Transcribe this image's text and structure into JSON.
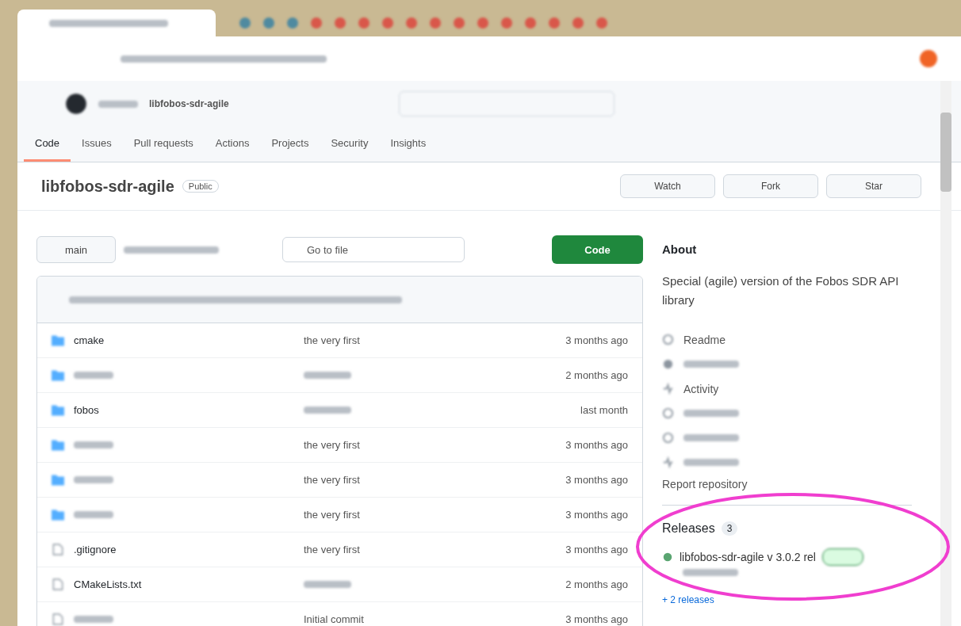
{
  "header": {
    "repo": "libfobos-sdr-agile"
  },
  "repo": {
    "name": "libfobos-sdr-agile",
    "visibility": "Public"
  },
  "nav_tabs": [
    {
      "label": "Code",
      "selected": true
    },
    {
      "label": "Issues",
      "selected": false
    },
    {
      "label": "Pull requests",
      "selected": false
    },
    {
      "label": "Actions",
      "selected": false
    },
    {
      "label": "Projects",
      "selected": false
    },
    {
      "label": "Security",
      "selected": false
    },
    {
      "label": "Insights",
      "selected": false
    }
  ],
  "repo_actions": [
    "Watch",
    "Fork",
    "Star"
  ],
  "branch": "main",
  "file_search": {
    "placeholder": "Go to file"
  },
  "code_button": "Code",
  "files": [
    {
      "kind": "folder",
      "name": "cmake",
      "message": "the very first",
      "age": "3 months ago"
    },
    {
      "kind": "folder",
      "age": "2 months ago"
    },
    {
      "kind": "folder",
      "name": "fobos",
      "age": "last month"
    },
    {
      "kind": "folder",
      "message": "the very first",
      "age": "3 months ago"
    },
    {
      "kind": "folder",
      "message": "the very first",
      "age": "3 months ago"
    },
    {
      "kind": "folder",
      "message": "the very first",
      "age": "3 months ago"
    },
    {
      "kind": "file",
      "name": ".gitignore",
      "message": "the very first",
      "age": "3 months ago"
    },
    {
      "kind": "file",
      "name": "CMakeLists.txt",
      "age": "2 months ago"
    },
    {
      "kind": "file",
      "message": "Initial commit",
      "age": "3 months ago"
    }
  ],
  "about": {
    "title": "About",
    "description": "Special (agile) version of the Fobos SDR API library",
    "links": [
      {
        "kind": "book",
        "label": "Readme"
      },
      {
        "kind": "scale"
      },
      {
        "kind": "pulse",
        "label": "Activity"
      },
      {
        "kind": "star"
      },
      {
        "kind": "eye"
      },
      {
        "kind": "fork"
      }
    ],
    "report": "Report repository"
  },
  "releases": {
    "title": "Releases",
    "count": "3",
    "latest": "libfobos-sdr-agile v 3.0.2 rel",
    "more": "+ 2 releases"
  }
}
